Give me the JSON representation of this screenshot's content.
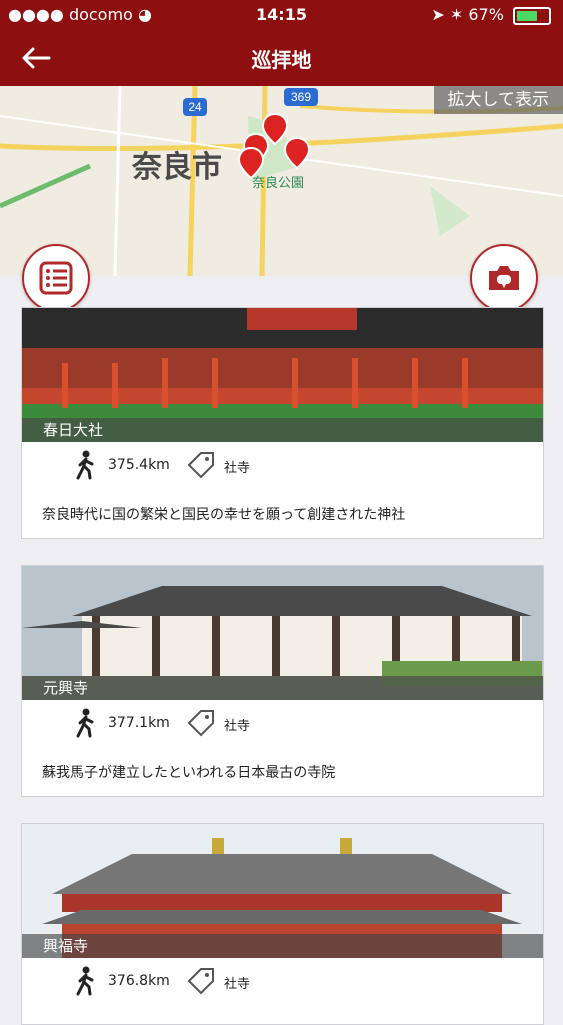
{
  "status": {
    "carrier": "docomo",
    "time": "14:15",
    "battery": "67%",
    "battery_level": 0.67
  },
  "header": {
    "title": "巡拝地"
  },
  "map": {
    "expand_label": "拡大して表示",
    "city_label": "奈良市",
    "park_label": "奈良公園",
    "road_a": "24",
    "road_b": "369"
  },
  "cards": [
    {
      "name": "春日大社",
      "distance": "375.4km",
      "category": "社寺",
      "description": "奈良時代に国の繁栄と国民の幸せを願って創建された神社"
    },
    {
      "name": "元興寺",
      "distance": "377.1km",
      "category": "社寺",
      "description": "蘇我馬子が建立したといわれる日本最古の寺院"
    },
    {
      "name": "興福寺",
      "distance": "376.8km",
      "category": "社寺",
      "description": ""
    }
  ]
}
